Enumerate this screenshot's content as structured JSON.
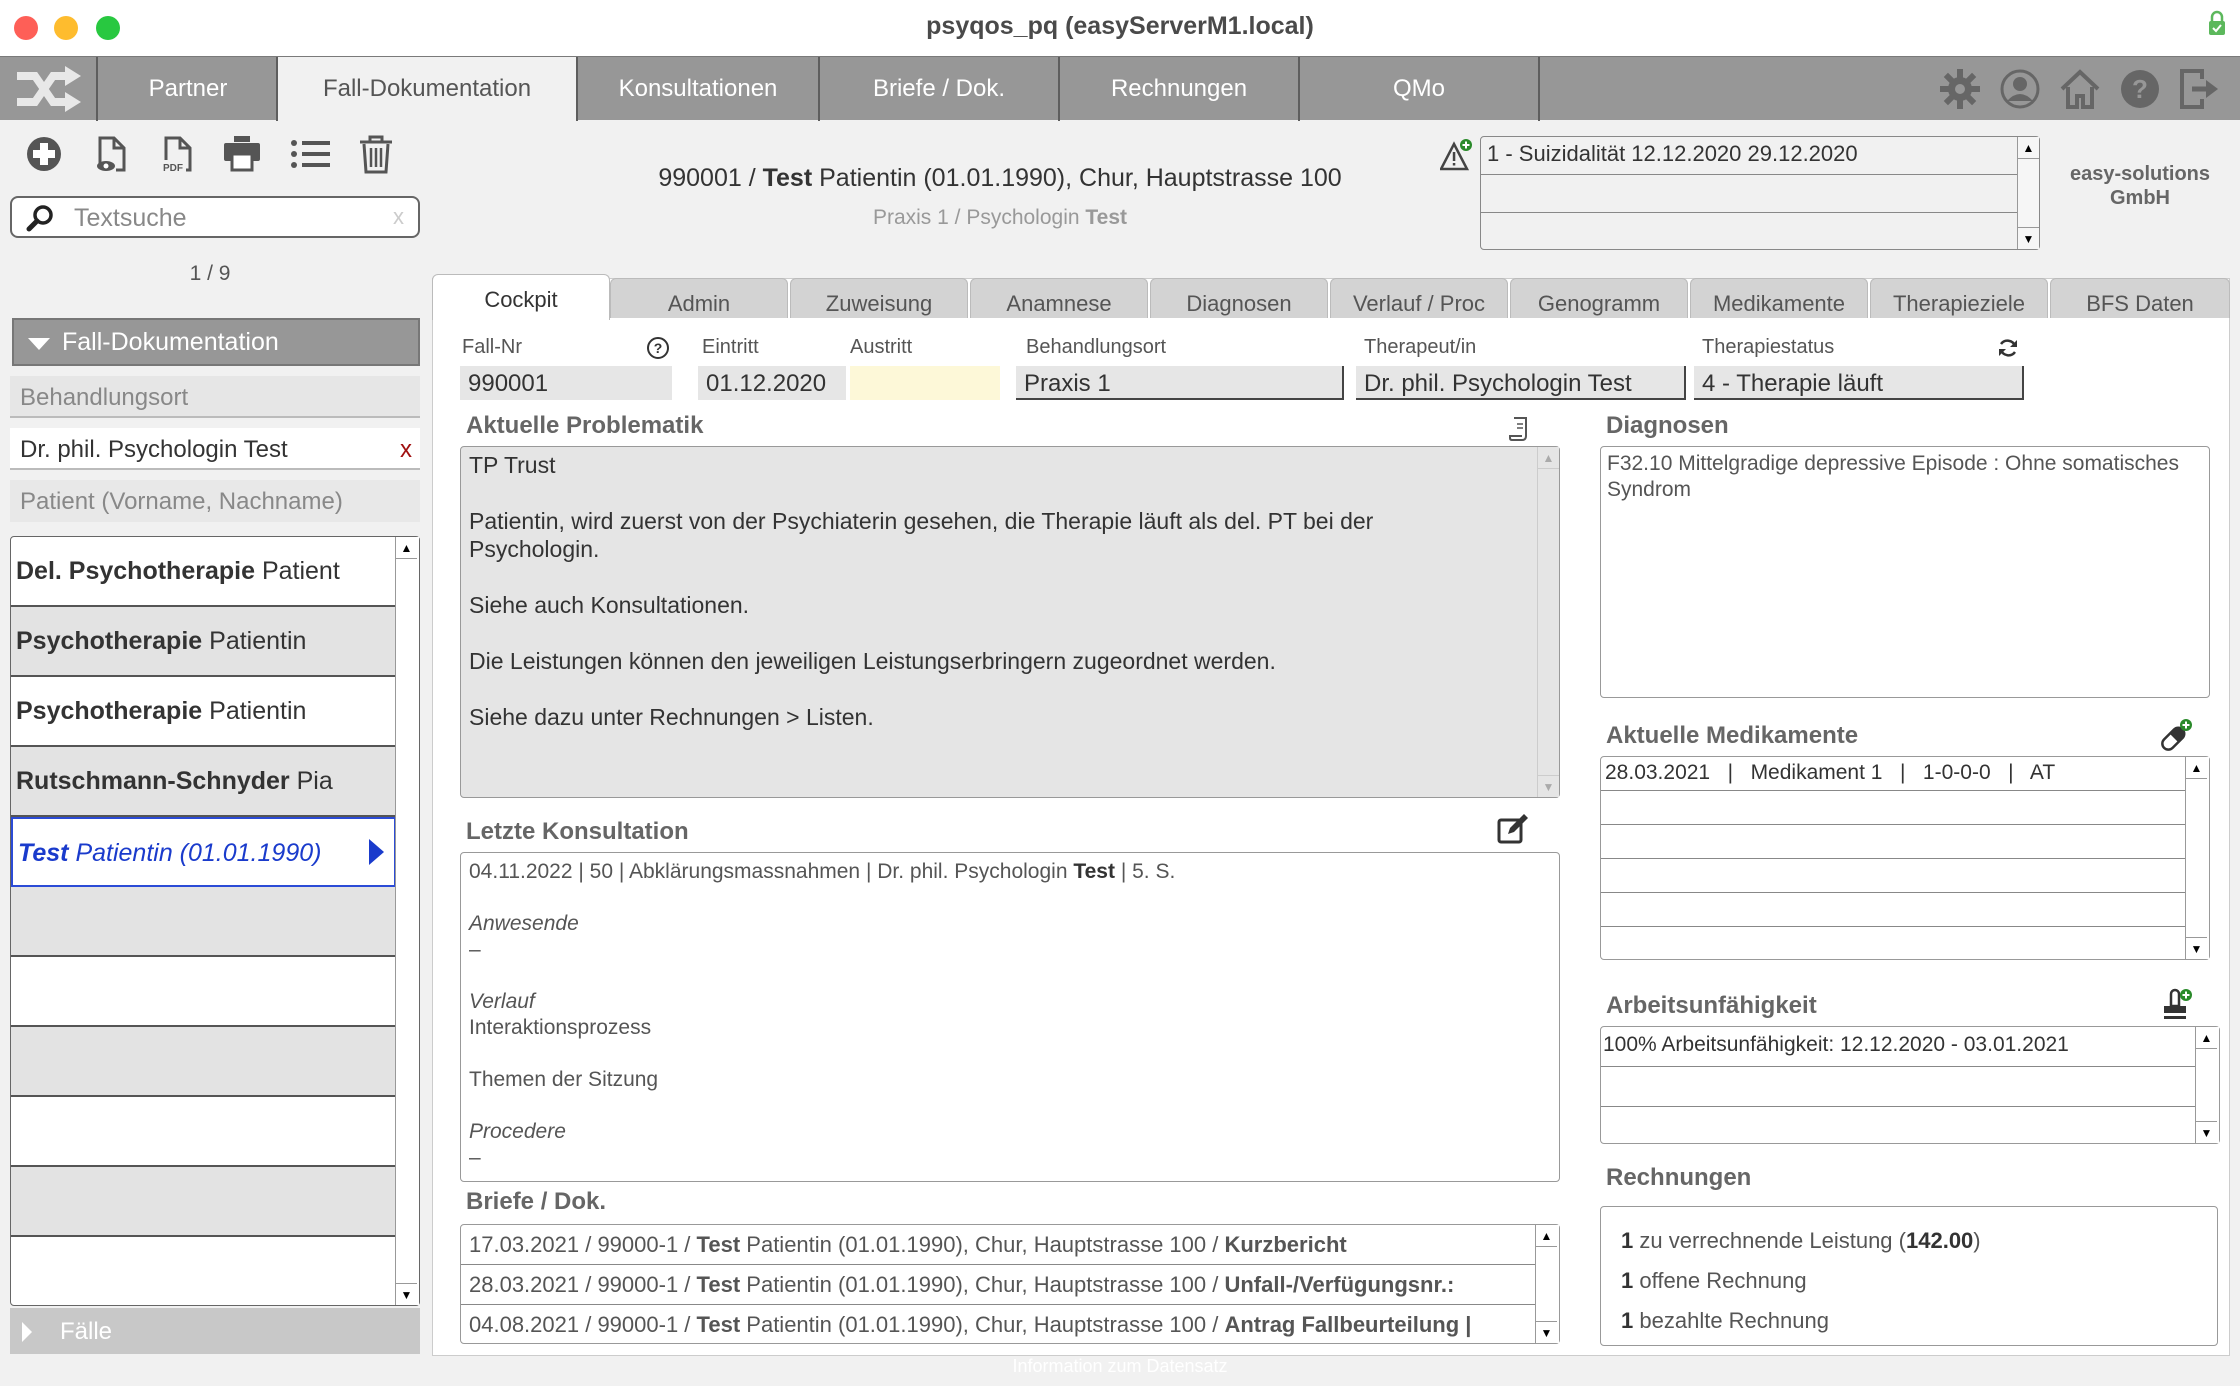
{
  "window": {
    "title": "psyqos_pq (easyServerM1.local)"
  },
  "nav": {
    "tabs": [
      {
        "label": "Partner",
        "active": false
      },
      {
        "label": "Fall-Dokumentation",
        "active": true
      },
      {
        "label": "Konsultationen",
        "active": false
      },
      {
        "label": "Briefe / Dok.",
        "active": false
      },
      {
        "label": "Rechnungen",
        "active": false
      },
      {
        "label": "QMo",
        "active": false
      }
    ],
    "right_icons": [
      "gear-icon",
      "user-icon",
      "home-icon",
      "help-icon",
      "logout-icon"
    ]
  },
  "toolbar": {
    "icons": [
      "add-icon",
      "preview-document-icon",
      "pdf-icon",
      "print-icon",
      "list-icon",
      "trash-icon"
    ],
    "search_placeholder": "Textsuche",
    "search_clear": "x",
    "record_counter": "1 / 9"
  },
  "header": {
    "case_no": "990001",
    "patient_lastname": "Test",
    "patient_rest": "Patientin (01.01.1990), Chur, Hauptstrasse 100",
    "practice": "Praxis 1 / Psychologin",
    "therapist_lastname": "Test",
    "warnings": [
      "1 - Suizidalität 12.12.2020  29.12.2020",
      "",
      ""
    ],
    "company_line1": "easy-solutions",
    "company_line2": "GmbH"
  },
  "sidebar": {
    "section_title": "Fall-Dokumentation",
    "filter_ort_placeholder": "Behandlungsort",
    "filter_therapist_value": "Dr. phil. Psychologin Test",
    "filter_therapist_clear": "x",
    "filter_patient_placeholder": "Patient (Vorname, Nachname)",
    "patients": [
      {
        "bold": "Del. Psychotherapie",
        "rest": "Patient",
        "selected": false
      },
      {
        "bold": "Psychotherapie",
        "rest": "Patientin",
        "selected": false
      },
      {
        "bold": "Psychotherapie",
        "rest": "Patientin",
        "selected": false
      },
      {
        "bold": "Rutschmann-Schnyder",
        "rest": "Pia",
        "selected": false
      },
      {
        "bold": "Test",
        "rest": "Patientin (01.01.1990)",
        "selected": true
      },
      {
        "bold": "",
        "rest": "",
        "selected": false
      },
      {
        "bold": "",
        "rest": "",
        "selected": false
      },
      {
        "bold": "",
        "rest": "",
        "selected": false
      },
      {
        "bold": "",
        "rest": "",
        "selected": false
      },
      {
        "bold": "",
        "rest": "",
        "selected": false
      },
      {
        "bold": "",
        "rest": "",
        "selected": false
      }
    ],
    "faelle_label": "Fälle"
  },
  "content_tabs": [
    {
      "label": "Cockpit",
      "active": true
    },
    {
      "label": "Admin",
      "active": false
    },
    {
      "label": "Zuweisung",
      "active": false
    },
    {
      "label": "Anamnese",
      "active": false
    },
    {
      "label": "Diagnosen",
      "active": false
    },
    {
      "label": "Verlauf / Proc",
      "active": false
    },
    {
      "label": "Genogramm",
      "active": false
    },
    {
      "label": "Medikamente",
      "active": false
    },
    {
      "label": "Therapieziele",
      "active": false
    },
    {
      "label": "BFS Daten",
      "active": false
    }
  ],
  "fields": {
    "fall_nr_label": "Fall-Nr",
    "fall_nr": "990001",
    "eintritt_label": "Eintritt",
    "eintritt": "01.12.2020",
    "austritt_label": "Austritt",
    "austritt": "",
    "behandlungsort_label": "Behandlungsort",
    "behandlungsort": "Praxis 1",
    "therapeut_label": "Therapeut/in",
    "therapeut": "Dr. phil. Psychologin Test",
    "therapiestatus_label": "Therapiestatus",
    "therapiestatus": "4 - Therapie läuft"
  },
  "problematik": {
    "title": "Aktuelle Problematik",
    "paragraphs": [
      "TP Trust",
      "Patientin, wird zuerst von der Psychiaterin gesehen, die Therapie läuft als del. PT bei der Psychologin.",
      "Siehe auch Konsultationen.",
      "Die Leistungen können den jeweiligen Leistungserbringern zugeordnet werden.",
      "Siehe dazu unter Rechnungen > Listen."
    ]
  },
  "konsultation": {
    "title": "Letzte Konsultation",
    "summary_pre": "04.11.2022 | 50 | Abklärungsmassnahmen | Dr. phil. Psychologin",
    "summary_bold": "Test",
    "summary_post": "| 5. S.",
    "anwesende_label": "Anwesende",
    "anwesende_value": "–",
    "verlauf_label": "Verlauf",
    "verlauf_value": "Interaktionsprozess",
    "themen_label": "Themen der Sitzung",
    "procedere_label": "Procedere",
    "procedere_value": "–"
  },
  "briefe": {
    "title": "Briefe / Dok.",
    "rows": [
      {
        "pre": "17.03.2021 / 99000-1 /",
        "name": "Test",
        "mid": "Patientin (01.01.1990), Chur, Hauptstrasse 100 /",
        "doc": "Kurzbericht"
      },
      {
        "pre": "28.03.2021 / 99000-1 /",
        "name": "Test",
        "mid": "Patientin (01.01.1990), Chur, Hauptstrasse 100 /",
        "doc": "Unfall-/Verfügungsnr.:"
      },
      {
        "pre": "04.08.2021 / 99000-1 /",
        "name": "Test",
        "mid": "Patientin (01.01.1990), Chur, Hauptstrasse 100 /",
        "doc": "Antrag Fallbeurteilung |"
      }
    ]
  },
  "diagnosen": {
    "title": "Diagnosen",
    "text": "F32.10   Mittelgradige depressive Episode : Ohne somatisches Syndrom"
  },
  "medikamente": {
    "title": "Aktuelle Medikamente",
    "rows": [
      "28.03.2021   |   Medikament 1   |   1-0-0-0   |   AT",
      "",
      "",
      "",
      ""
    ]
  },
  "auf": {
    "title": "Arbeitsunfähigkeit",
    "rows": [
      "100% Arbeitsunfähigkeit:  12.12.2020 - 03.01.2021",
      "",
      ""
    ]
  },
  "rechnungen": {
    "title": "Rechnungen",
    "items": [
      {
        "count": "1",
        "text": "zu verrechnende Leistung (",
        "amount": "142.00",
        "tail": ")"
      },
      {
        "count": "1",
        "text": "offene Rechnung",
        "amount": "",
        "tail": ""
      },
      {
        "count": "1",
        "text": "bezahlte Rechnung",
        "amount": "",
        "tail": ""
      }
    ]
  },
  "footer": {
    "info": "Information zum Datensatz"
  },
  "colors": {
    "nav_bg": "#979797",
    "selection_blue": "#1a3bcc",
    "austritt_bg": "#fdf8d8",
    "clear_red": "#a01010",
    "badge_green": "#2a8a2a"
  }
}
